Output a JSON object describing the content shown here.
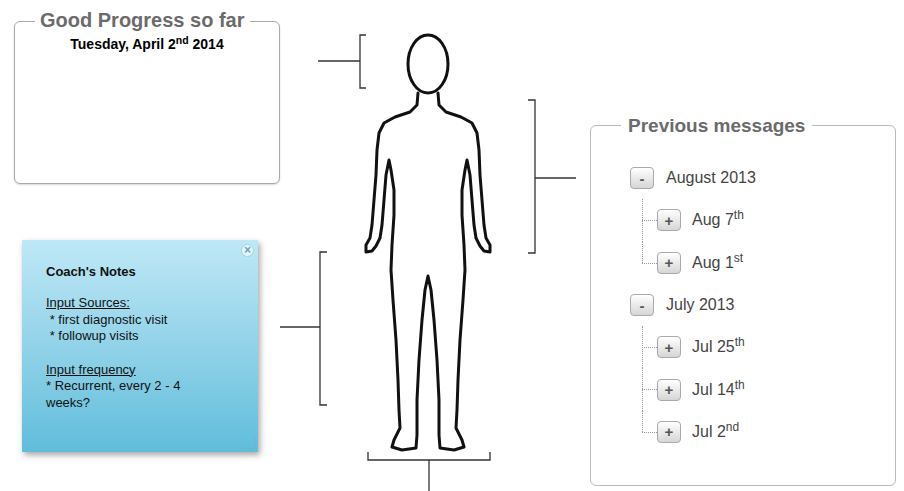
{
  "progress_box": {
    "title": "Good Progress so far",
    "date": {
      "text": "Tuesday, April 2",
      "suffix": "nd",
      "year": " 2014"
    }
  },
  "coach_notes": {
    "close_icon": "×",
    "title": "Coach's Notes",
    "sections": [
      {
        "heading": "Input Sources:",
        "lines": [
          " * first diagnostic visit",
          " * followup visits"
        ]
      },
      {
        "heading": "Input frequency",
        "lines": [
          "* Recurrent, every 2 - 4 weeks?"
        ]
      }
    ]
  },
  "messages": {
    "title": "Previous messages",
    "groups": [
      {
        "label": "August 2013",
        "toggle": "-",
        "expanded": true,
        "items": [
          {
            "label": "Aug 7",
            "suffix": "th",
            "toggle": "+",
            "expanded": false
          },
          {
            "label": "Aug 1",
            "suffix": "st",
            "toggle": "+",
            "expanded": false
          }
        ]
      },
      {
        "label": "July 2013",
        "toggle": "-",
        "expanded": true,
        "items": [
          {
            "label": "Jul 25",
            "suffix": "th",
            "toggle": "+",
            "expanded": false
          },
          {
            "label": "Jul 14",
            "suffix": "th",
            "toggle": "+",
            "expanded": false
          },
          {
            "label": "Jul 2",
            "suffix": "nd",
            "toggle": "+",
            "expanded": false
          }
        ]
      }
    ]
  }
}
